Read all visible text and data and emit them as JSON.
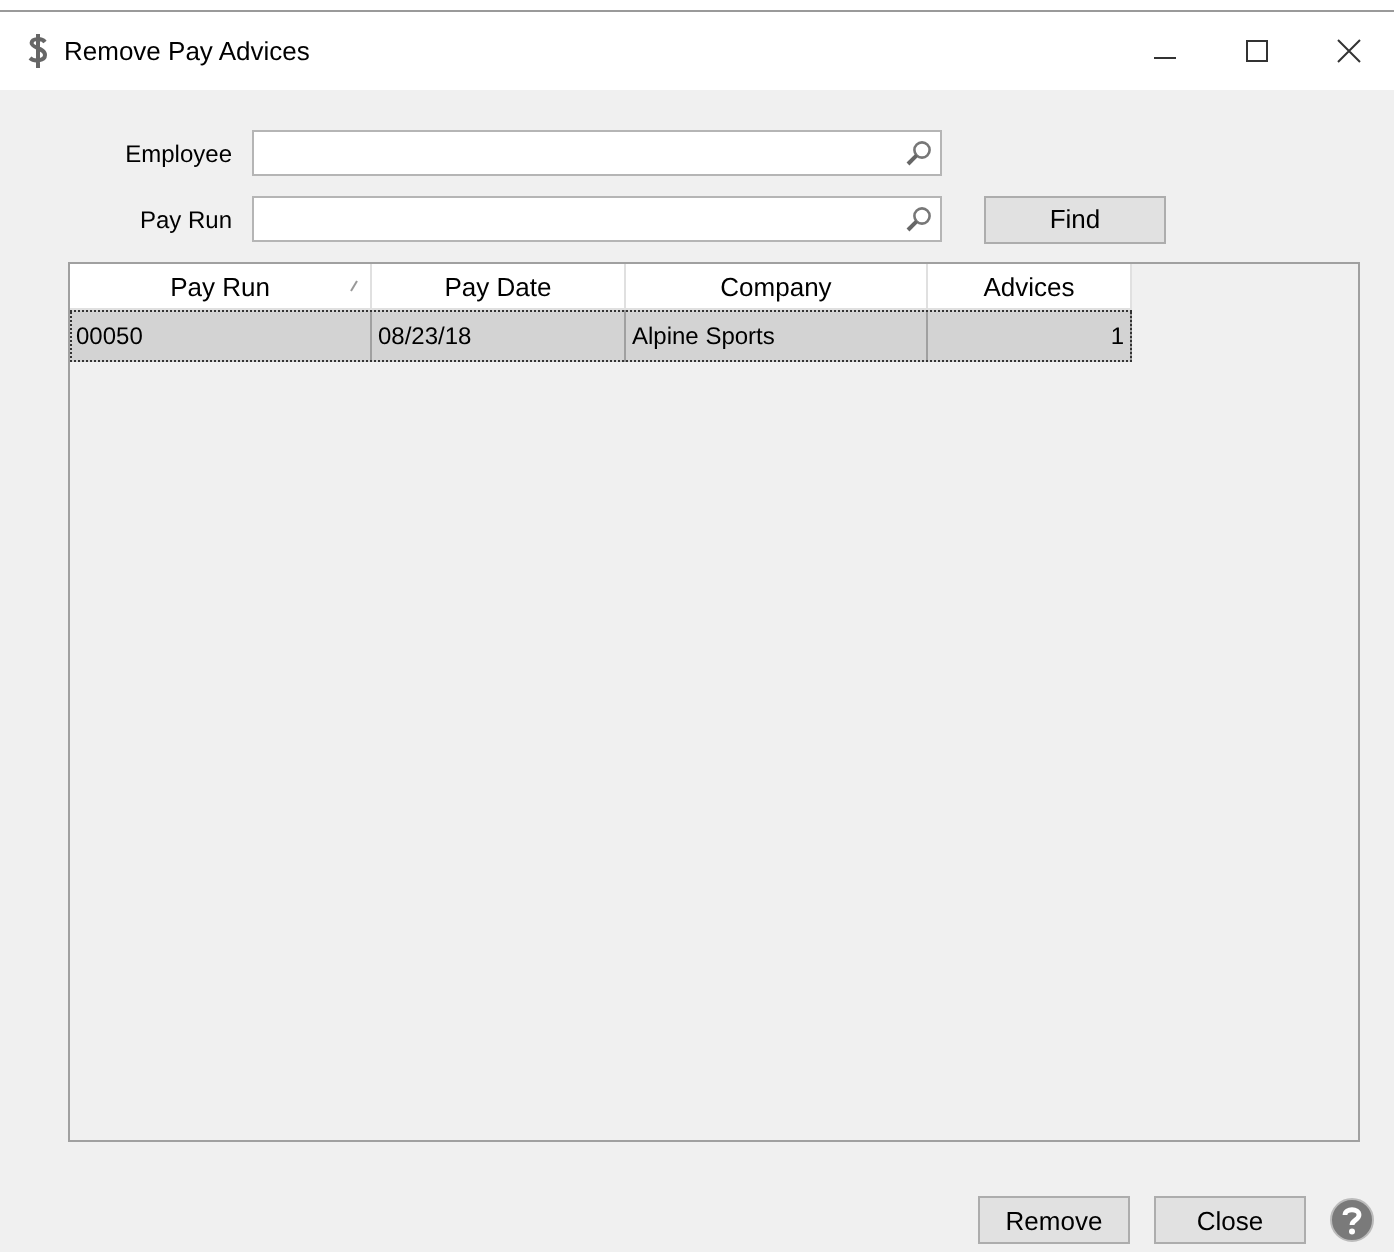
{
  "window": {
    "title": "Remove Pay Advices"
  },
  "filters": [
    {
      "label": "Employee"
    },
    {
      "label": "Pay Run"
    }
  ],
  "find_button": "Find",
  "table": {
    "columns": [
      {
        "label": "Pay Run",
        "sorted": true
      },
      {
        "label": "Pay Date",
        "sorted": false
      },
      {
        "label": "Company",
        "sorted": false
      },
      {
        "label": "Advices",
        "sorted": false
      }
    ],
    "rows": [
      {
        "cells": [
          "00050",
          "08/23/18",
          "Alpine Sports",
          "1"
        ],
        "selected": true
      }
    ]
  },
  "buttons": [
    "Remove",
    "Close"
  ]
}
